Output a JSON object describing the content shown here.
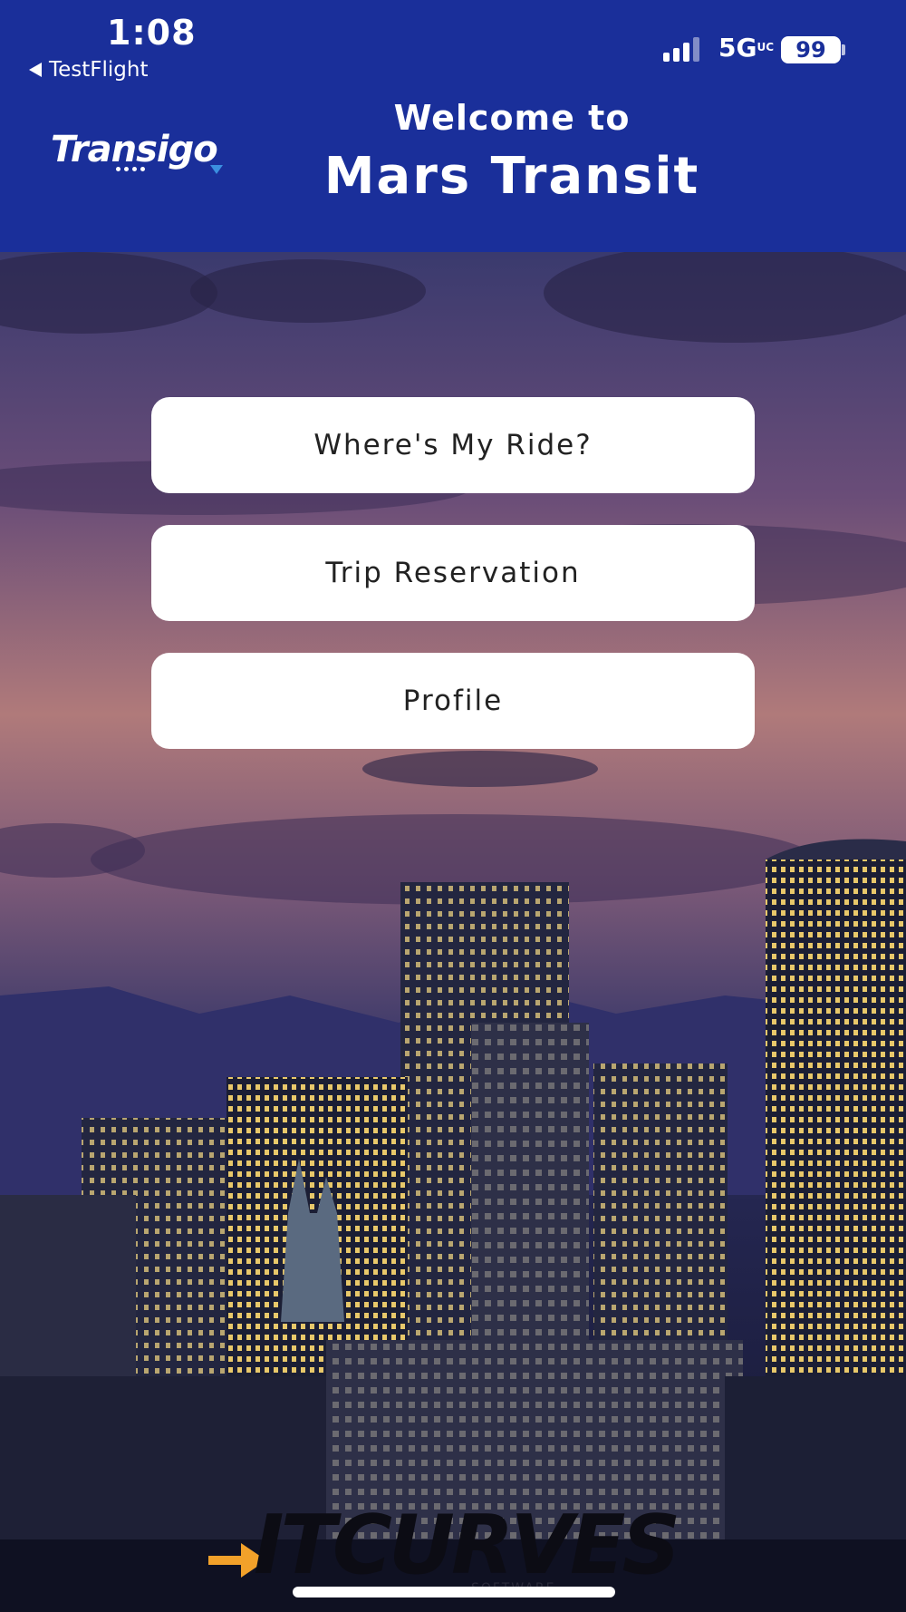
{
  "status_bar": {
    "time": "1:08",
    "back_label": "TestFlight",
    "network": "5G",
    "network_suffix": "UC",
    "battery": "99"
  },
  "header": {
    "logo_text": "Transigo",
    "welcome": "Welcome to",
    "title": "Mars Transit"
  },
  "menu": {
    "where_my_ride": "Where's  My Ride?",
    "trip_reservation": "Trip Reservation",
    "profile": "Profile"
  },
  "footer": {
    "brand": "ITCURVES",
    "tagline": "SOFTWARE"
  },
  "colors": {
    "header_bg": "#1a2f9a",
    "button_bg": "#ffffff",
    "accent_arrow": "#f2a12a"
  }
}
